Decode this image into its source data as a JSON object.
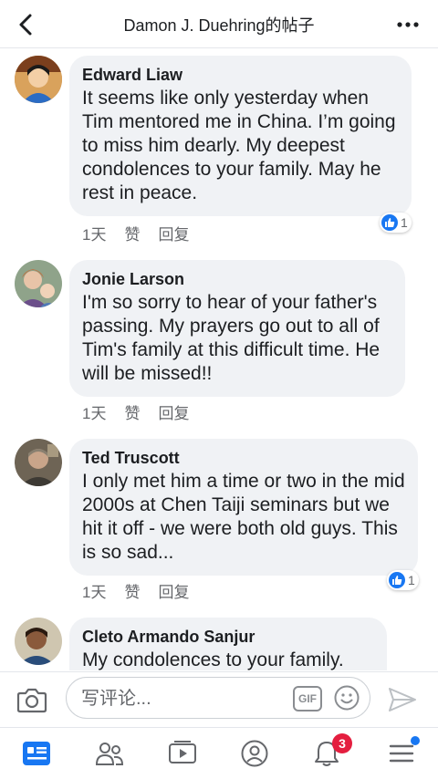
{
  "header": {
    "title": "Damon J. Duehring的帖子",
    "back_icon": "back-chevron-icon",
    "more_icon": "more-dots-icon"
  },
  "comments": [
    {
      "name": "Edward Liaw",
      "text": "It seems like only yesterday when Tim mentored me in China.  I’m going to miss him dearly.  My deepest condolences to your family.  May he rest in peace.",
      "time": "1天",
      "like": "赞",
      "reply": "回复",
      "reactions": "1"
    },
    {
      "name": "Jonie Larson",
      "text": "I'm so sorry to hear of your father's passing.  My prayers go out to all of Tim's family at this difficult time.  He will be missed!!",
      "time": "1天",
      "like": "赞",
      "reply": "回复"
    },
    {
      "name": "Ted Truscott",
      "text": "I only met him a time or two in the mid 2000s at Chen Taiji  seminars but we hit it off - we were both old guys. This is so sad...",
      "time": "1天",
      "like": "赞",
      "reply": "回复",
      "reactions": "1"
    },
    {
      "name": "Cleto Armando Sanjur",
      "text": "My condolences to your family."
    }
  ],
  "composer": {
    "placeholder": "写评论...",
    "gif_label": "GIF"
  },
  "tabbar": {
    "notifications_badge": "3"
  },
  "colors": {
    "accent": "#1877f2",
    "bubble": "#f0f2f5",
    "badge": "#e41e3f"
  }
}
